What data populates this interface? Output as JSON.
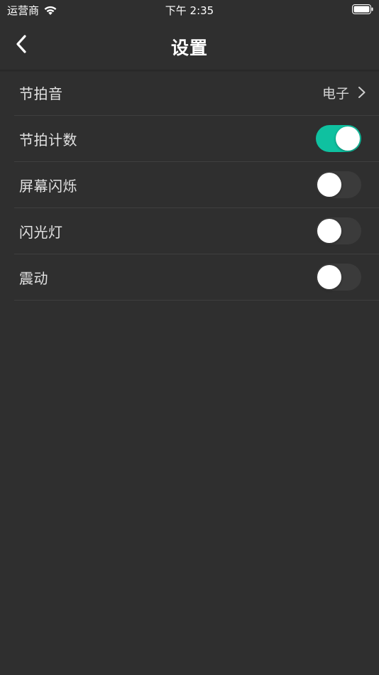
{
  "status_bar": {
    "carrier": "运营商",
    "time": "下午 2:35",
    "wifi_icon": "wifi-icon",
    "battery_icon": "battery-full-icon"
  },
  "nav": {
    "title": "设置",
    "back_icon": "chevron-left-icon"
  },
  "settings": {
    "items": [
      {
        "label": "节拍音",
        "value": "电子",
        "type": "disclosure"
      },
      {
        "label": "节拍计数",
        "type": "toggle",
        "on": true
      },
      {
        "label": "屏幕闪烁",
        "type": "toggle",
        "on": false
      },
      {
        "label": "闪光灯",
        "type": "toggle",
        "on": false
      },
      {
        "label": "震动",
        "type": "toggle",
        "on": false
      }
    ]
  },
  "colors": {
    "background": "#2f2f2f",
    "toggle_on": "#0fc1a0",
    "toggle_off": "#3b3b3b"
  }
}
